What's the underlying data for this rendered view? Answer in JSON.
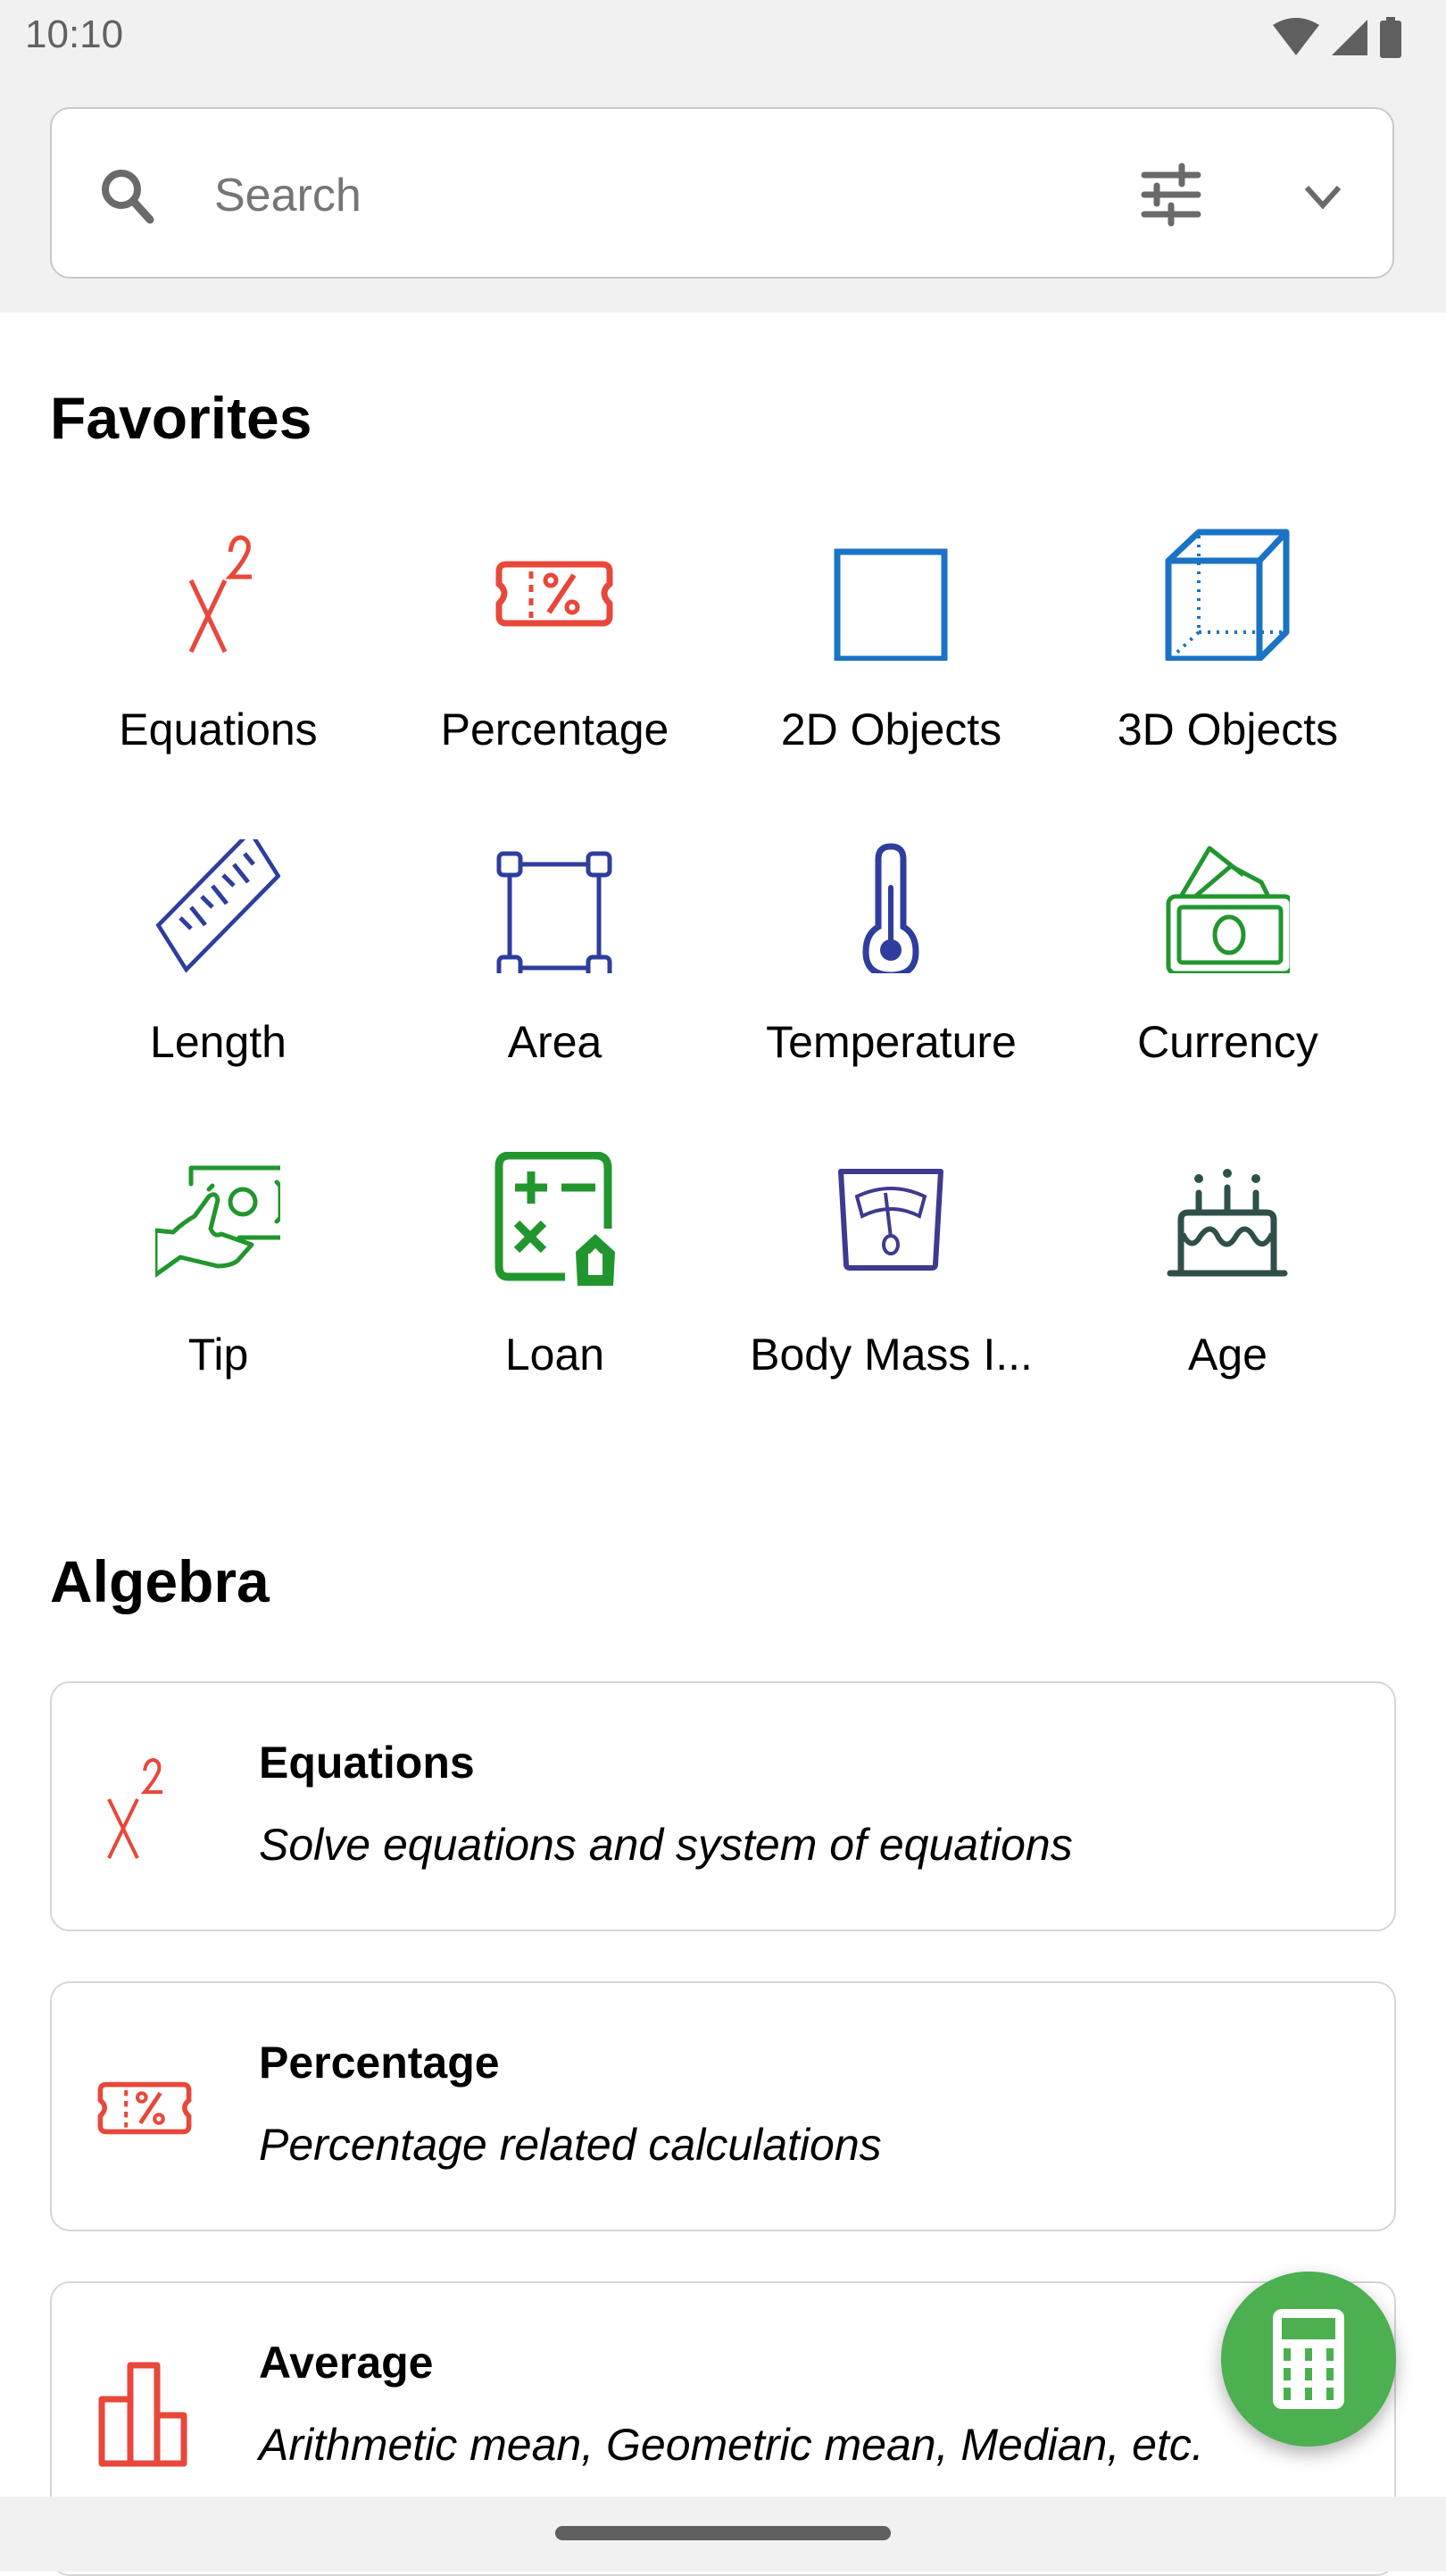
{
  "status_bar": {
    "time": "10:10",
    "icons": [
      "wifi-icon",
      "cellular-signal-icon",
      "battery-icon"
    ]
  },
  "search": {
    "placeholder": "Search",
    "value": "",
    "icons": [
      "search-icon",
      "filter-sliders-icon",
      "chevron-down-icon"
    ]
  },
  "favorites": {
    "title": "Favorites",
    "items": [
      {
        "label": "Equations",
        "icon": "x-squared-icon",
        "color": "#e8473a"
      },
      {
        "label": "Percentage",
        "icon": "percent-ticket-icon",
        "color": "#e8473a"
      },
      {
        "label": "2D Objects",
        "icon": "square-icon",
        "color": "#1a73c4"
      },
      {
        "label": "3D Objects",
        "icon": "cube-icon",
        "color": "#1a73c4"
      },
      {
        "label": "Length",
        "icon": "ruler-icon",
        "color": "#2e3d9e"
      },
      {
        "label": "Area",
        "icon": "area-selection-icon",
        "color": "#2e3d9e"
      },
      {
        "label": "Temperature",
        "icon": "thermometer-icon",
        "color": "#2e3d9e"
      },
      {
        "label": "Currency",
        "icon": "money-stack-icon",
        "color": "#22962e"
      },
      {
        "label": "Tip",
        "icon": "hand-money-icon",
        "color": "#22962e"
      },
      {
        "label": "Loan",
        "icon": "loan-calculator-icon",
        "color": "#22962e"
      },
      {
        "label": "Body Mass I...",
        "icon": "weight-scale-icon",
        "color": "#3e3a8f"
      },
      {
        "label": "Age",
        "icon": "birthday-cake-icon",
        "color": "#2f4f4a"
      }
    ]
  },
  "algebra": {
    "title": "Algebra",
    "cards": [
      {
        "title": "Equations",
        "description": "Solve equations and system of equations",
        "icon": "x-squared-icon"
      },
      {
        "title": "Percentage",
        "description": "Percentage related calculations",
        "icon": "percent-ticket-icon"
      },
      {
        "title": "Average",
        "description": "Arithmetic mean, Geometric mean, Median, etc.",
        "icon": "bar-chart-icon"
      }
    ]
  },
  "fab": {
    "icon": "calculator-icon",
    "color": "#4caf50"
  },
  "colors": {
    "red": "#e8473a",
    "blue": "#1a73c4",
    "navy": "#2e3d9e",
    "green": "#22962e",
    "purple": "#3e3a8f",
    "slate": "#2f4f4a"
  }
}
